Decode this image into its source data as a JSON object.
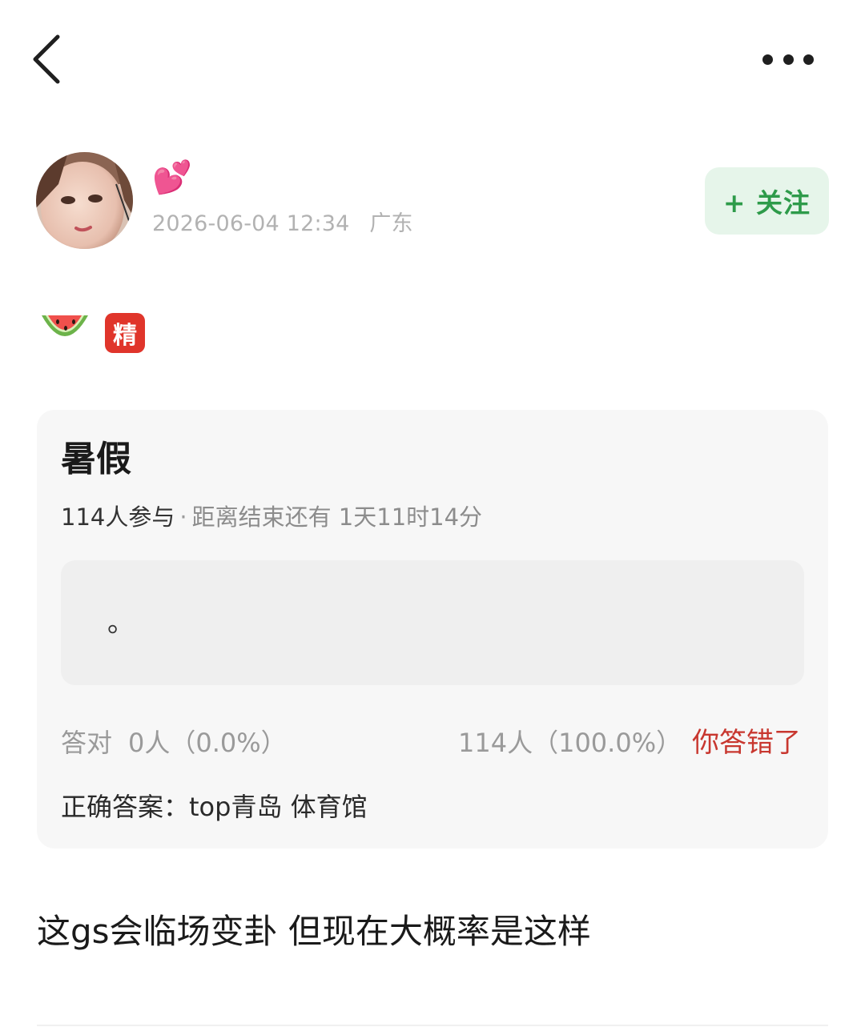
{
  "topbar": {
    "back_icon": "chevron-left-icon",
    "more_icon": "more-dots-icon"
  },
  "author": {
    "nickname": "💕",
    "datetime": "2026-06-04 12:34",
    "location": "广东",
    "follow_label": "+ 关注"
  },
  "badges": {
    "emoji": "watermelon-icon",
    "featured_label": "精"
  },
  "quiz": {
    "title": "暑假",
    "participants": "114人参与",
    "separator": "·",
    "countdown": "距离结束还有 1天11时14分",
    "answer_text": "。",
    "correct_label": "答对",
    "correct_count": "0人（0.0%）",
    "wrong_count": "114人（100.0%）",
    "result_label": "你答错了",
    "right_answer": "正确答案：top青岛 体育馆"
  },
  "post": {
    "text": "这gs会临场变卦 但现在大概率是这样"
  },
  "colors": {
    "follow_bg": "#e6f5ea",
    "follow_text": "#2e9b4a",
    "badge_red": "#e0352b",
    "wrong_red": "#c8372f",
    "card_bg": "#f7f7f7"
  }
}
